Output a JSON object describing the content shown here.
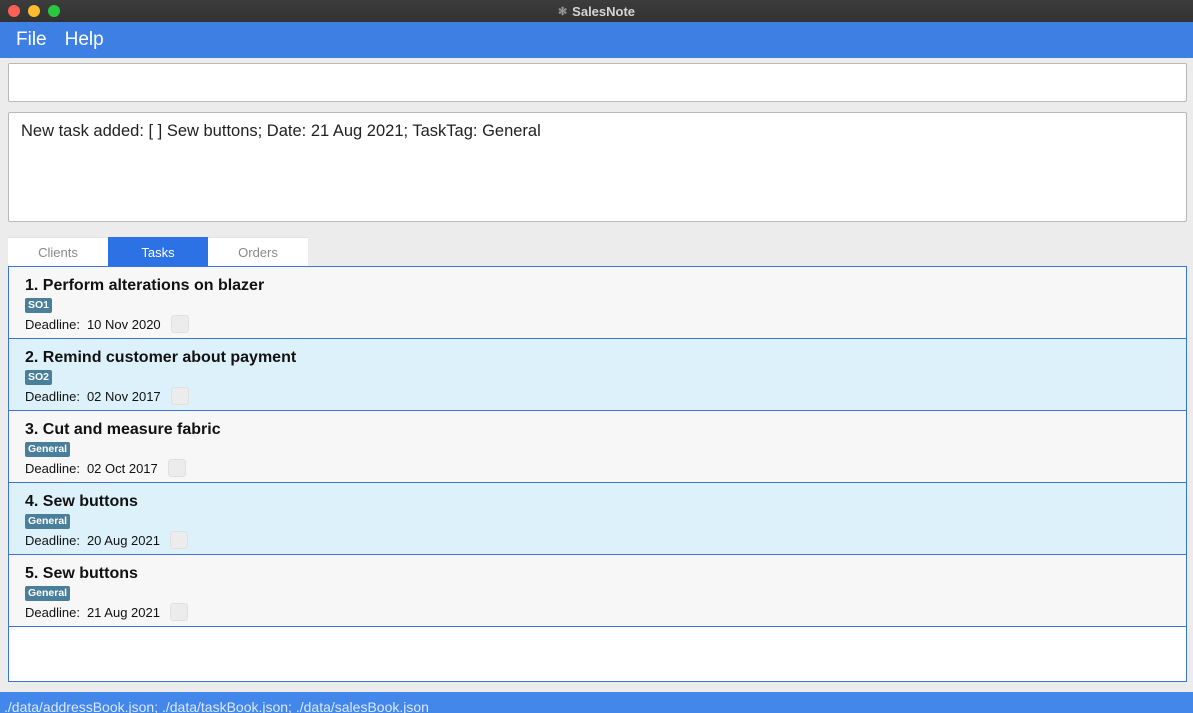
{
  "window": {
    "title": "SalesNote"
  },
  "menu": {
    "file": "File",
    "help": "Help"
  },
  "command": {
    "value": "",
    "placeholder": ""
  },
  "result": {
    "text": "New task added: [ ] Sew buttons; Date: 21 Aug 2021; TaskTag: General"
  },
  "tabs": [
    {
      "label": "Clients",
      "active": false
    },
    {
      "label": "Tasks",
      "active": true
    },
    {
      "label": "Orders",
      "active": false
    }
  ],
  "tasks": [
    {
      "title": "1.  Perform alterations on blazer",
      "tag": "SO1",
      "deadline_label": "Deadline:",
      "deadline": "10 Nov 2020",
      "done": false
    },
    {
      "title": "2.  Remind customer about payment",
      "tag": "SO2",
      "deadline_label": "Deadline:",
      "deadline": "02 Nov 2017",
      "done": false
    },
    {
      "title": "3.  Cut and measure fabric",
      "tag": "General",
      "deadline_label": "Deadline:",
      "deadline": "02 Oct 2017",
      "done": false
    },
    {
      "title": "4.  Sew buttons",
      "tag": "General",
      "deadline_label": "Deadline:",
      "deadline": "20 Aug 2021",
      "done": false
    },
    {
      "title": "5.  Sew buttons",
      "tag": "General",
      "deadline_label": "Deadline:",
      "deadline": "21 Aug 2021",
      "done": false
    }
  ],
  "status": {
    "text": "./data/addressBook.json; ./data/taskBook.json; ./data/salesBook.json"
  },
  "colors": {
    "accent": "#3e7fe4",
    "tab_active": "#2d72e4",
    "tag_bg": "#4a7f9b",
    "row_alt": "#ddf1fb",
    "border": "#3b74d6"
  }
}
